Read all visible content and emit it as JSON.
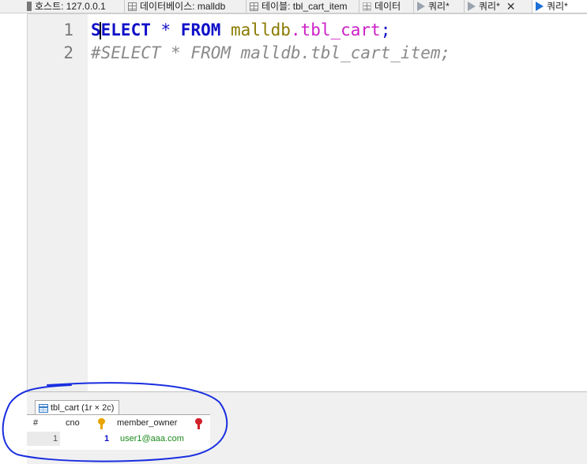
{
  "tabs": [
    {
      "label": "호스트: 127.0.0.1",
      "icon": "server-icon"
    },
    {
      "label": "데이터베이스: malldb",
      "icon": "database-icon"
    },
    {
      "label": "테이블: tbl_cart_item",
      "icon": "table-icon"
    },
    {
      "label": "데이터",
      "icon": "grid-icon"
    },
    {
      "label": "쿼리*",
      "icon": "play-icon"
    },
    {
      "label": "쿼리*",
      "icon": "play-icon"
    },
    {
      "label": "쿼리*",
      "icon": "play-icon",
      "active": true
    }
  ],
  "editor": {
    "line_numbers": [
      "1",
      "2"
    ],
    "line1": {
      "kw1": "SELECT",
      "star": " * ",
      "kw2": "FROM",
      "sp": " ",
      "db": "malldb",
      "dot": ".",
      "table": "tbl_cart",
      "end": ";"
    },
    "line2": "#SELECT * FROM malldb.tbl_cart_item;"
  },
  "result": {
    "tab_label": "tbl_cart (1r × 2c)",
    "columns": [
      "#",
      "cno",
      "member_owner"
    ],
    "rows": [
      {
        "num": "1",
        "cno": "1",
        "member_owner": "user1@aaa.com"
      }
    ]
  },
  "colors": {
    "keyword": "#1010c8",
    "database": "#8a7a00",
    "table": "#cc20c8",
    "comment": "#8a8a8a",
    "annotation": "#1a2ee0"
  }
}
